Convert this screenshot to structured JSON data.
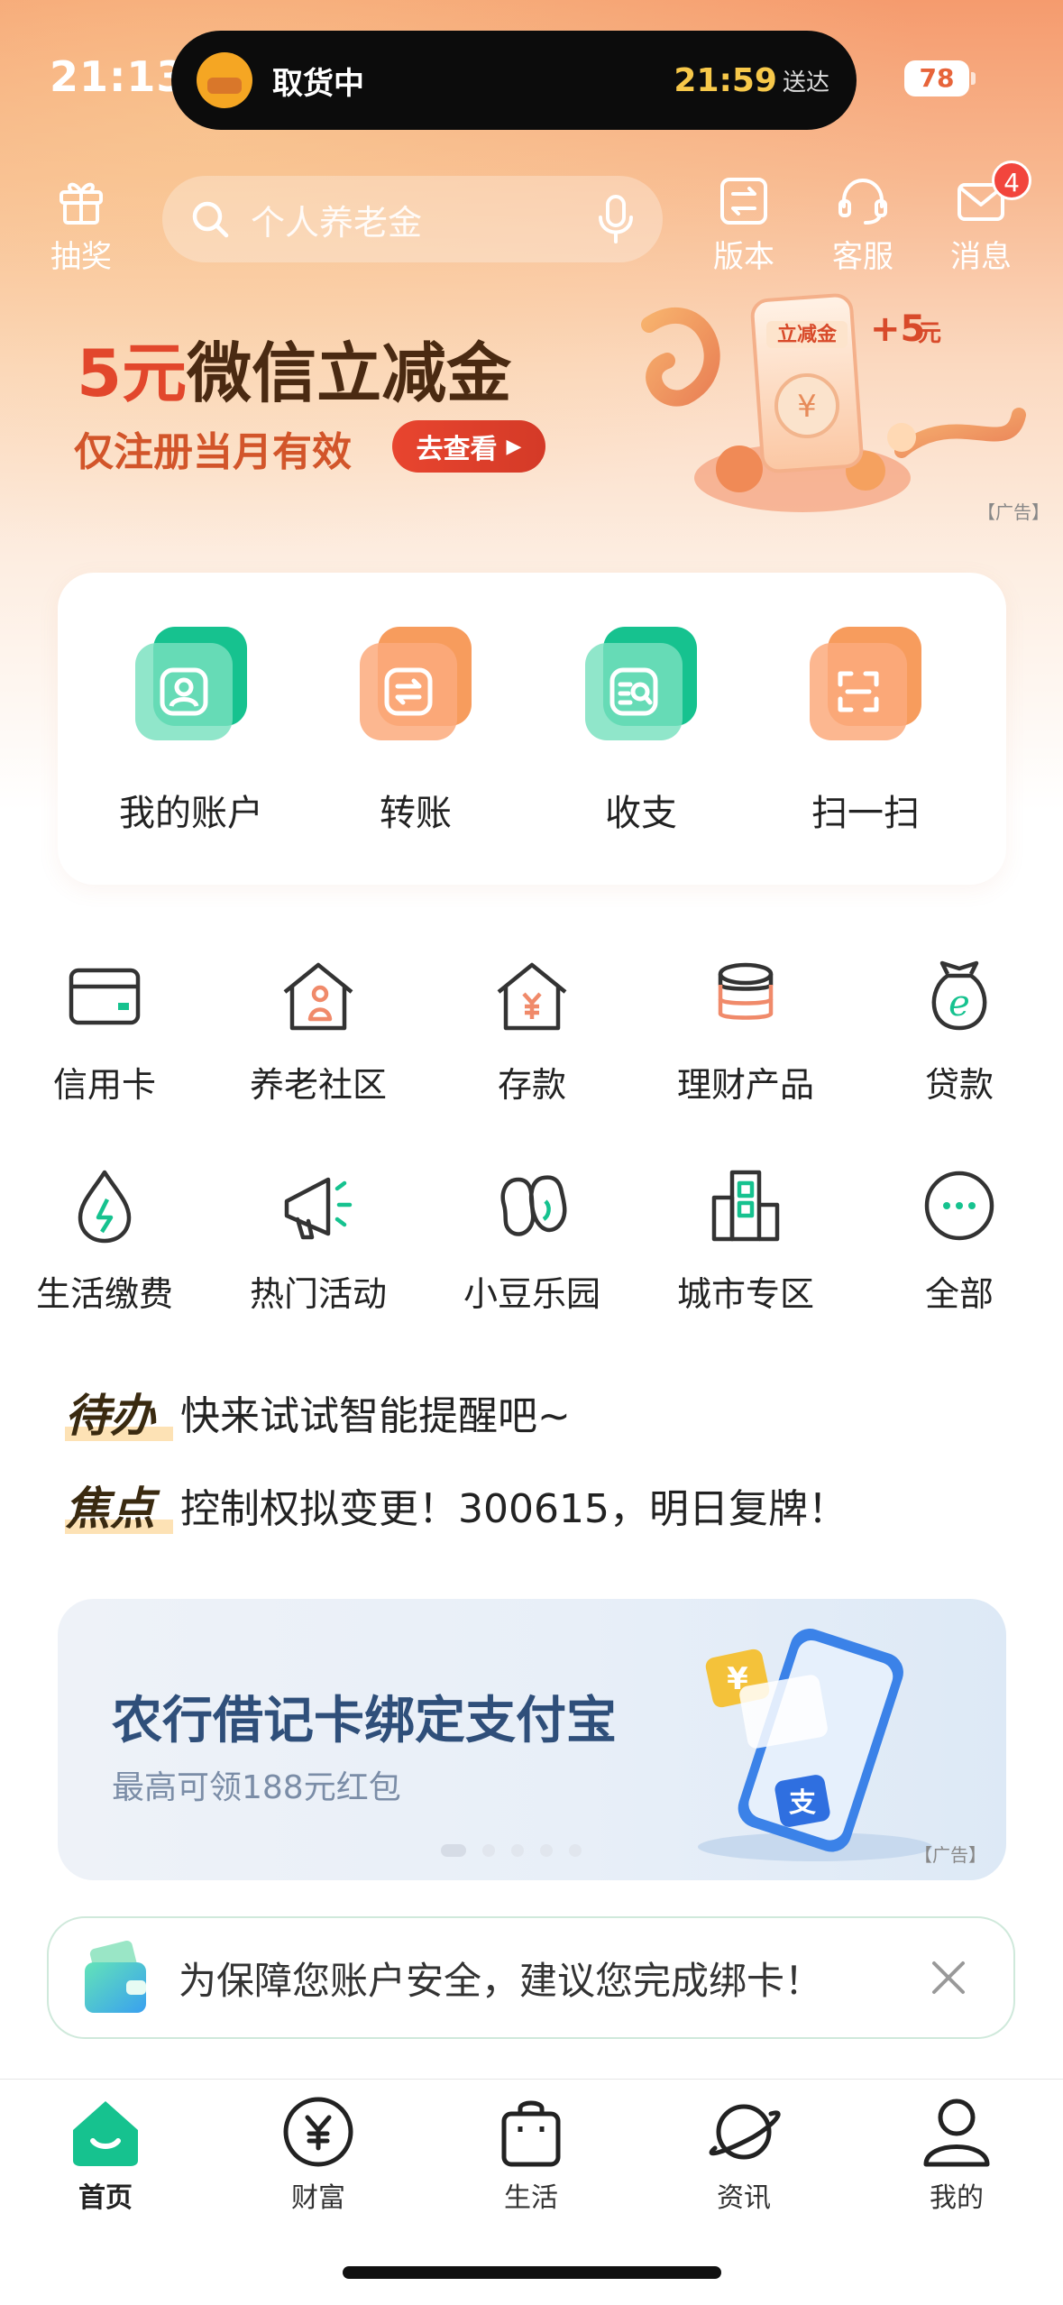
{
  "status_bar": {
    "time": "21:13",
    "live_activity_label": "取货中",
    "live_activity_eta": "21:59",
    "live_activity_eta_suffix": "送达",
    "battery": "78"
  },
  "header": {
    "lottery_label": "抽奖",
    "search_placeholder": "个人养老金",
    "version_label": "版本",
    "service_label": "客服",
    "messages_label": "消息",
    "messages_badge": "4"
  },
  "banner": {
    "title_highlight": "5元",
    "title_rest": "微信立减金",
    "subtitle": "仅注册当月有效",
    "button": "去查看",
    "art_label": "立减金",
    "art_amount": "+5",
    "art_unit": "元",
    "ad_tag": "【广告】"
  },
  "quick_actions": [
    {
      "label": "我的账户",
      "icon": "account-icon",
      "color": "green"
    },
    {
      "label": "转账",
      "icon": "transfer-icon",
      "color": "orange"
    },
    {
      "label": "收支",
      "icon": "income-expense-icon",
      "color": "green"
    },
    {
      "label": "扫一扫",
      "icon": "scan-icon",
      "color": "orange"
    }
  ],
  "grid": [
    {
      "label": "信用卡",
      "icon": "credit-card-icon"
    },
    {
      "label": "养老社区",
      "icon": "elder-community-icon"
    },
    {
      "label": "存款",
      "icon": "deposit-icon"
    },
    {
      "label": "理财产品",
      "icon": "wealth-product-icon"
    },
    {
      "label": "贷款",
      "icon": "loan-icon"
    },
    {
      "label": "生活缴费",
      "icon": "utility-payment-icon"
    },
    {
      "label": "热门活动",
      "icon": "megaphone-icon"
    },
    {
      "label": "小豆乐园",
      "icon": "bean-park-icon"
    },
    {
      "label": "城市专区",
      "icon": "city-zone-icon"
    },
    {
      "label": "全部",
      "icon": "more-icon"
    }
  ],
  "todo": {
    "tag": "待办",
    "text": "快来试试智能提醒吧~"
  },
  "focus": {
    "tag": "焦点",
    "text": "控制权拟变更！300615，明日复牌！"
  },
  "promo": {
    "title": "农行借记卡绑定支付宝",
    "subtitle": "最高可领188元红包",
    "ad_tag": "【广告】"
  },
  "notice": {
    "text": "为保障您账户安全，建议您完成绑卡！"
  },
  "tabs": [
    {
      "label": "首页",
      "icon": "home-icon",
      "active": true
    },
    {
      "label": "财富",
      "icon": "wealth-icon",
      "active": false
    },
    {
      "label": "生活",
      "icon": "shopping-bag-icon",
      "active": false
    },
    {
      "label": "资讯",
      "icon": "planet-icon",
      "active": false
    },
    {
      "label": "我的",
      "icon": "user-icon",
      "active": false
    }
  ],
  "colors": {
    "accent_green": "#16c28f",
    "accent_orange": "#f79c5d",
    "banner_red": "#e2472c"
  }
}
